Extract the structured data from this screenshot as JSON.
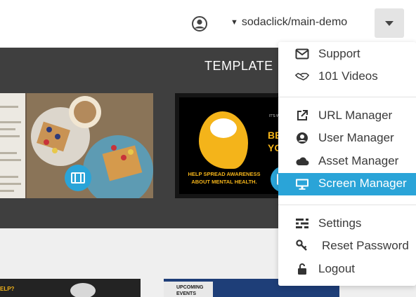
{
  "header": {
    "user_icon": "user-circle-icon",
    "repo_caret": "▼",
    "repo_label": "sodaclick/main-demo",
    "menu_toggle_icon": "caret-down-icon"
  },
  "banner": {
    "title": "TEMPLATE",
    "thumbnails": [
      {
        "icon": "film-icon",
        "alt": "food photo template"
      },
      {
        "icon": "film-icon",
        "headline": "BE YO",
        "small_text": "IT'S WO",
        "message": "HELP SPREAD AWARENESS ABOUT MENTAL HEALTH."
      }
    ]
  },
  "bottom_cards": [
    {
      "text": "ELP?"
    },
    {
      "text": "UPCOMING EVENTS"
    }
  ],
  "dropdown": {
    "items": [
      {
        "label": "Support",
        "icon": "envelope-icon"
      },
      {
        "label": "101 Videos",
        "icon": "handshake-icon"
      },
      {
        "label": "URL Manager",
        "icon": "external-link-icon"
      },
      {
        "label": "User Manager",
        "icon": "user-circle-icon"
      },
      {
        "label": "Asset Manager",
        "icon": "cloud-icon"
      },
      {
        "label": "Screen Manager",
        "icon": "desktop-icon",
        "active": true
      },
      {
        "label": "Settings",
        "icon": "settings-sliders-icon"
      },
      {
        "label": "Reset Password",
        "icon": "key-icon"
      },
      {
        "label": "Logout",
        "icon": "unlock-icon"
      }
    ]
  },
  "colors": {
    "accent": "#2aa4d8",
    "banner_bg": "#3f3f3f",
    "page_bg": "#efefef",
    "mental_health_yellow": "#f4b41a"
  }
}
